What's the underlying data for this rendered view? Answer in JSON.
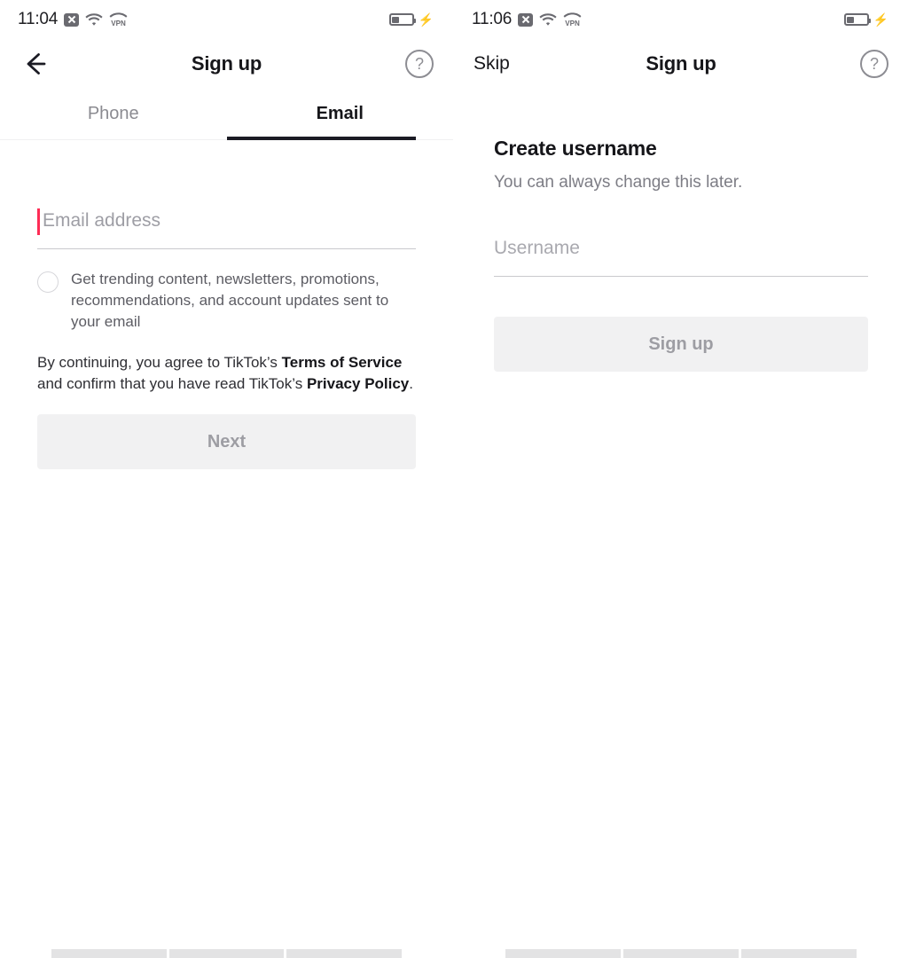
{
  "left": {
    "status": {
      "time": "11:04",
      "icons": [
        "x-badge-icon",
        "wifi-icon",
        "vpn-icon"
      ],
      "battery_level": "38",
      "charging": true
    },
    "nav": {
      "back_icon": "back-arrow-icon",
      "title": "Sign up",
      "help_icon": "help-circle-icon",
      "help_glyph": "?"
    },
    "tabs": [
      {
        "label": "Phone",
        "active": false
      },
      {
        "label": "Email",
        "active": true
      }
    ],
    "email_field": {
      "placeholder": "Email address",
      "value": "",
      "caret_color": "#fe2c55",
      "focused": true
    },
    "consent": {
      "checked": false,
      "text": "Get trending content, newsletters, promotions, recommendations, and account updates sent to your email"
    },
    "terms": {
      "lead": "By continuing, you agree to TikTok’s ",
      "link1": "Terms of Service",
      "middle": " and confirm that you have read TikTok’s ",
      "link2": "Privacy Policy",
      "tail": "."
    },
    "cta": {
      "label": "Next",
      "enabled": false
    }
  },
  "right": {
    "status": {
      "time": "11:06",
      "icons": [
        "x-badge-icon",
        "wifi-icon",
        "vpn-icon"
      ],
      "battery_level": "38",
      "charging": true
    },
    "nav": {
      "skip_label": "Skip",
      "title": "Sign up",
      "help_icon": "help-circle-icon",
      "help_glyph": "?"
    },
    "heading": "Create username",
    "subheading": "You can always change this later.",
    "username_field": {
      "placeholder": "Username",
      "value": "",
      "focused": false
    },
    "cta": {
      "label": "Sign up",
      "enabled": false
    }
  },
  "colors": {
    "accent": "#fe2c55",
    "text_primary": "#16161a",
    "text_secondary": "#7d7d85",
    "disabled_bg": "#f1f1f2",
    "disabled_text": "#9d9da3",
    "divider": "#c9c9cd"
  }
}
